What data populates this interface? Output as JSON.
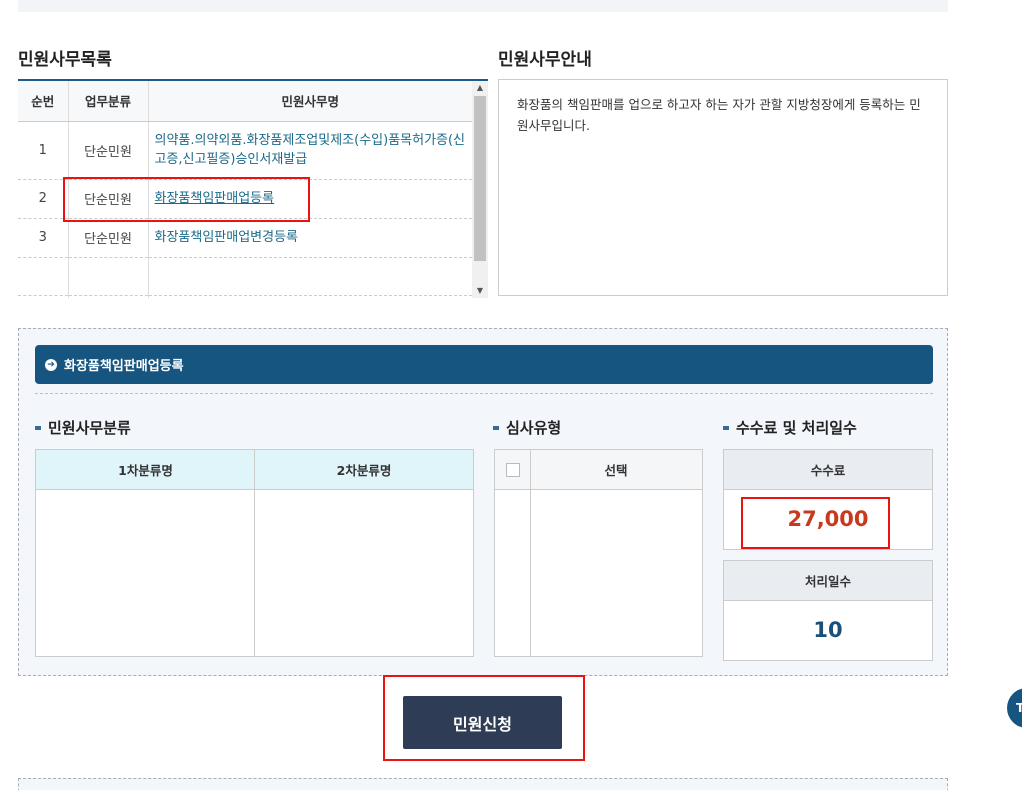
{
  "list_section": {
    "title": "민원사무목록",
    "columns": [
      "순번",
      "업무분류",
      "민원사무명"
    ],
    "rows": [
      {
        "no": "1",
        "category": "단순민원",
        "name": "의약품.의약외품.화장품제조업및제조(수입)품목허가증(신고증,신고필증)승인서재발급"
      },
      {
        "no": "2",
        "category": "단순민원",
        "name": "화장품책임판매업등록"
      },
      {
        "no": "3",
        "category": "단순민원",
        "name": "화장품책임판매업변경등록"
      }
    ]
  },
  "info_section": {
    "title": "민원사무안내",
    "text": "화장품의 책임판매를 업으로 하고자 하는 자가 관할 지방청장에게 등록하는 민원사무입니다."
  },
  "detail": {
    "header": "화장품책임판매업등록",
    "classification": {
      "title": "민원사무분류",
      "col1": "1차분류명",
      "col2": "2차분류명"
    },
    "review": {
      "title": "심사유형",
      "col": "선택"
    },
    "fee": {
      "title": "수수료 및 처리일수",
      "fee_label": "수수료",
      "fee_value": "27,000",
      "days_label": "처리일수",
      "days_value": "10"
    }
  },
  "apply_button": "민원신청",
  "float_button": "T",
  "colors": {
    "header_blue": "#165580",
    "fee_red": "#c8391e",
    "days_blue": "#1a4f7a",
    "button_dark": "#2e3d55",
    "highlight_red": "#e11111"
  }
}
